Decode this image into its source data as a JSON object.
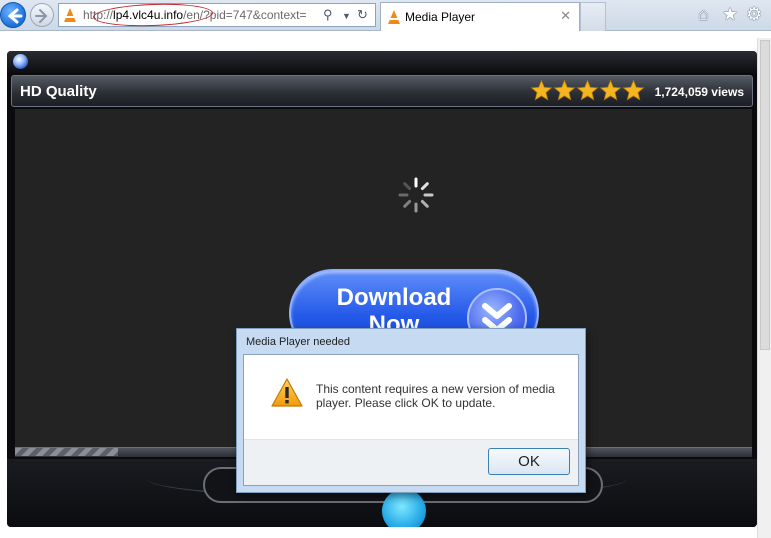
{
  "browser": {
    "url_protocol": "http://",
    "url_domain": "lp4.vlc4u.info",
    "url_rest": "/en/?pid=747&context=",
    "tab_title": "Media Player",
    "tab_close": "✕",
    "icons": [
      "back-icon",
      "forward-icon",
      "search-icon",
      "dropdown-icon",
      "refresh-icon",
      "vlc-icon",
      "home-icon",
      "favorites-icon",
      "settings-icon"
    ]
  },
  "player": {
    "title": "HD Quality",
    "rating": 5,
    "rating_max": 5,
    "views": "1,724,059 views",
    "download_label": "Download Now",
    "progress": 0.14,
    "colors": {
      "accent": "#2358e8",
      "star": "#f5b521",
      "play": "#22a7e6"
    }
  },
  "dialog": {
    "title": "Media Player needed",
    "message": "This content requires a new version of media player. Please click OK to update.",
    "ok_label": "OK"
  }
}
